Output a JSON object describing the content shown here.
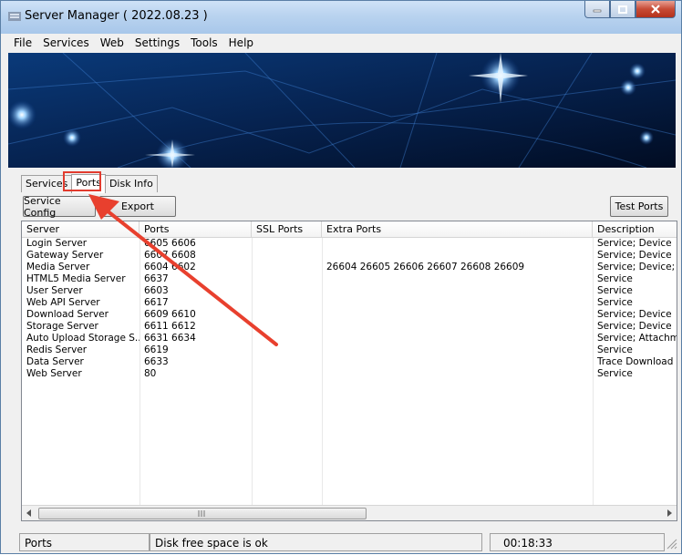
{
  "window": {
    "title": "Server Manager ( 2022.08.23 )"
  },
  "menu": [
    "File",
    "Services",
    "Web",
    "Settings",
    "Tools",
    "Help"
  ],
  "tabs": [
    "Services",
    "Ports",
    "Disk Info"
  ],
  "active_tab": "Ports",
  "toolbar": {
    "service_config": "Service Config",
    "export": "Export",
    "test_ports": "Test Ports"
  },
  "table": {
    "columns": [
      "Server",
      "Ports",
      "SSL Ports",
      "Extra Ports",
      "Description"
    ],
    "rows": [
      [
        "Login Server",
        "6605 6606",
        "",
        "",
        "Service; Device"
      ],
      [
        "Gateway Server",
        "6607 6608",
        "",
        "",
        "Service; Device"
      ],
      [
        "Media Server",
        "6604 6602",
        "",
        "26604 26605 26606 26607 26608 26609",
        "Service; Device; W"
      ],
      [
        "HTML5 Media Server",
        "6637",
        "",
        "",
        "Service"
      ],
      [
        "User Server",
        "6603",
        "",
        "",
        "Service"
      ],
      [
        "Web API Server",
        "6617",
        "",
        "",
        "Service"
      ],
      [
        "Download Server",
        "6609 6610",
        "",
        "",
        "Service; Device"
      ],
      [
        "Storage Server",
        "6611 6612",
        "",
        "",
        "Service; Device"
      ],
      [
        "Auto Upload Storage S...",
        "6631 6634",
        "",
        "",
        "Service; Attachme"
      ],
      [
        "Redis Server",
        "6619",
        "",
        "",
        "Service"
      ],
      [
        "Data Server",
        "6633",
        "",
        "",
        "Trace Download"
      ],
      [
        "Web Server",
        "80",
        "",
        "",
        "Service"
      ]
    ]
  },
  "status": {
    "panel1": "Ports",
    "panel2": "Disk free space is ok",
    "panel3": "00:18:33"
  },
  "colors": {
    "highlight": "#e23b2e",
    "titlebar": "#b9d3ef"
  }
}
